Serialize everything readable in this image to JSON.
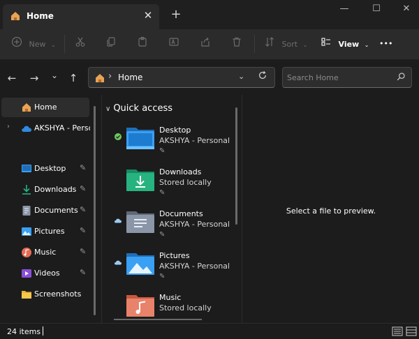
{
  "window": {
    "tab_title": "Home",
    "tab_close": "✕",
    "new_tab": "+",
    "minimize": "—",
    "maximize": "☐",
    "close": "✕"
  },
  "toolbar": {
    "new_label": "New",
    "sort_label": "Sort",
    "view_label": "View",
    "more_label": "•••"
  },
  "nav": {
    "back": "←",
    "forward": "→",
    "recent": "⌄",
    "up": "↑",
    "address_text": "Home",
    "address_separator": "›",
    "search_placeholder": "Search Home"
  },
  "sidebar": {
    "items": [
      {
        "label": "Home",
        "icon": "home-icon"
      },
      {
        "label": "AKSHYA - Perso",
        "icon": "onedrive-cloud-icon"
      },
      {
        "label": "Desktop",
        "icon": "desktop-icon"
      },
      {
        "label": "Downloads",
        "icon": "download-icon"
      },
      {
        "label": "Documents",
        "icon": "documents-icon"
      },
      {
        "label": "Pictures",
        "icon": "pictures-icon"
      },
      {
        "label": "Music",
        "icon": "music-icon"
      },
      {
        "label": "Videos",
        "icon": "videos-icon"
      },
      {
        "label": "Screenshots",
        "icon": "folder-icon"
      }
    ]
  },
  "quick_access": {
    "header": "Quick access",
    "folders": [
      {
        "name": "Desktop",
        "sub": "AKSHYA - Personal",
        "status": "synced-check-icon"
      },
      {
        "name": "Downloads",
        "sub": "Stored locally",
        "status": "none"
      },
      {
        "name": "Documents",
        "sub": "AKSHYA - Personal",
        "status": "cloud-icon"
      },
      {
        "name": "Pictures",
        "sub": "AKSHYA - Personal",
        "status": "cloud-icon"
      },
      {
        "name": "Music",
        "sub": "Stored locally",
        "status": "none"
      }
    ]
  },
  "preview": {
    "message": "Select a file to preview."
  },
  "status": {
    "item_count": "24 items"
  },
  "colors": {
    "background": "#1c1c1c",
    "toolbar": "#2b2b2b",
    "accent_blue": "#3aa0f3",
    "sync_green": "#6ccb5f",
    "home_orange": "#e8a355"
  }
}
